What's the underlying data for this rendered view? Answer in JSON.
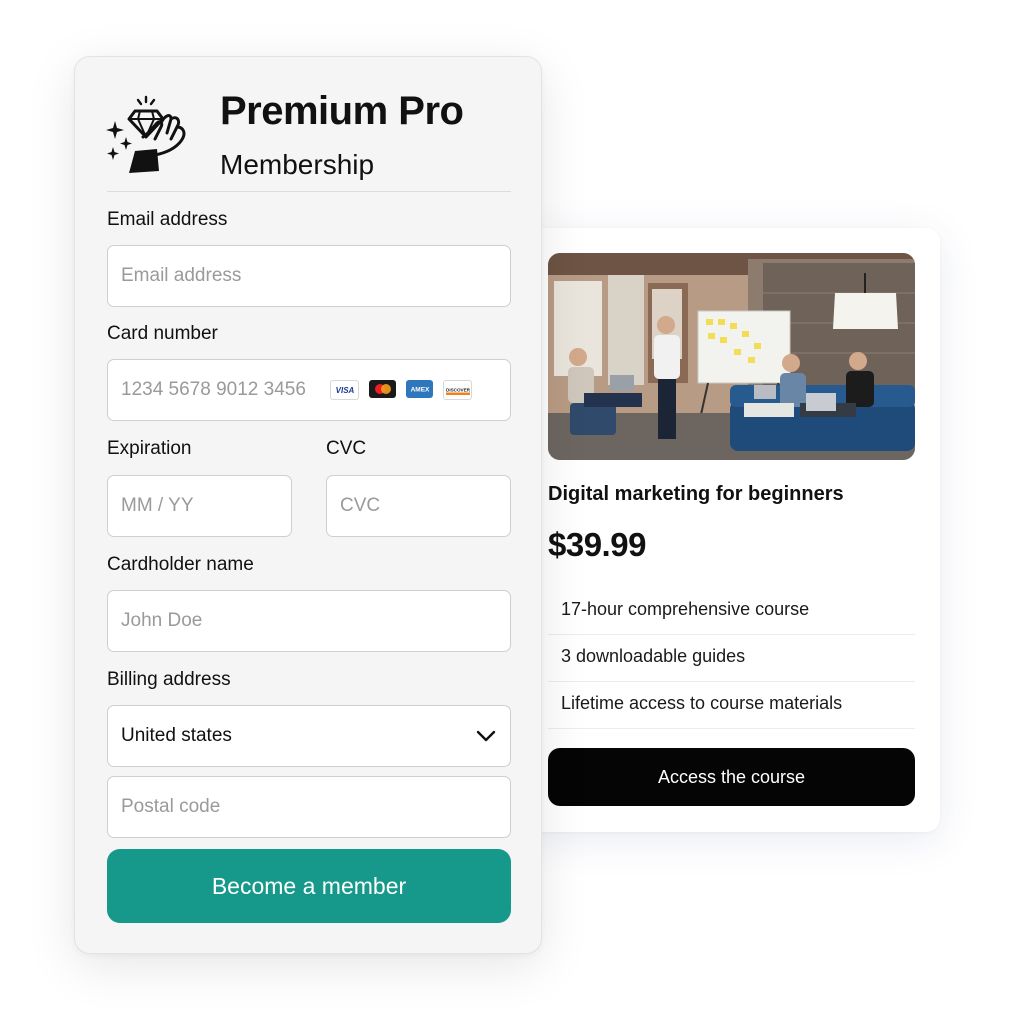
{
  "membership": {
    "title": "Premium Pro",
    "subtitle": "Membership",
    "logo_icon": "diamond-ring-hand-icon",
    "email": {
      "label": "Email address",
      "placeholder": "Email address"
    },
    "card": {
      "label": "Card number",
      "placeholder": "1234 5678 9012 3456",
      "brands": [
        {
          "name": "VISA",
          "icon": "visa-icon"
        },
        {
          "name": "Mastercard",
          "icon": "mastercard-icon"
        },
        {
          "name": "AMEX",
          "icon": "amex-icon"
        },
        {
          "name": "DISCOVER",
          "icon": "discover-icon"
        }
      ]
    },
    "expiration": {
      "label": "Expiration",
      "placeholder": "MM / YY"
    },
    "cvc": {
      "label": "CVC",
      "placeholder": "CVC"
    },
    "cardholder": {
      "label": "Cardholder name",
      "placeholder": "John Doe"
    },
    "billing": {
      "label": "Billing address",
      "country_value": "United states",
      "postal_placeholder": "Postal code"
    },
    "submit_label": "Become a member",
    "accent_color": "#16988a"
  },
  "course": {
    "title": "Digital marketing for beginners",
    "price": "$39.99",
    "features": [
      "17-hour comprehensive course",
      "3 downloadable guides",
      "Lifetime access to course materials"
    ],
    "cta_label": "Access the course"
  }
}
